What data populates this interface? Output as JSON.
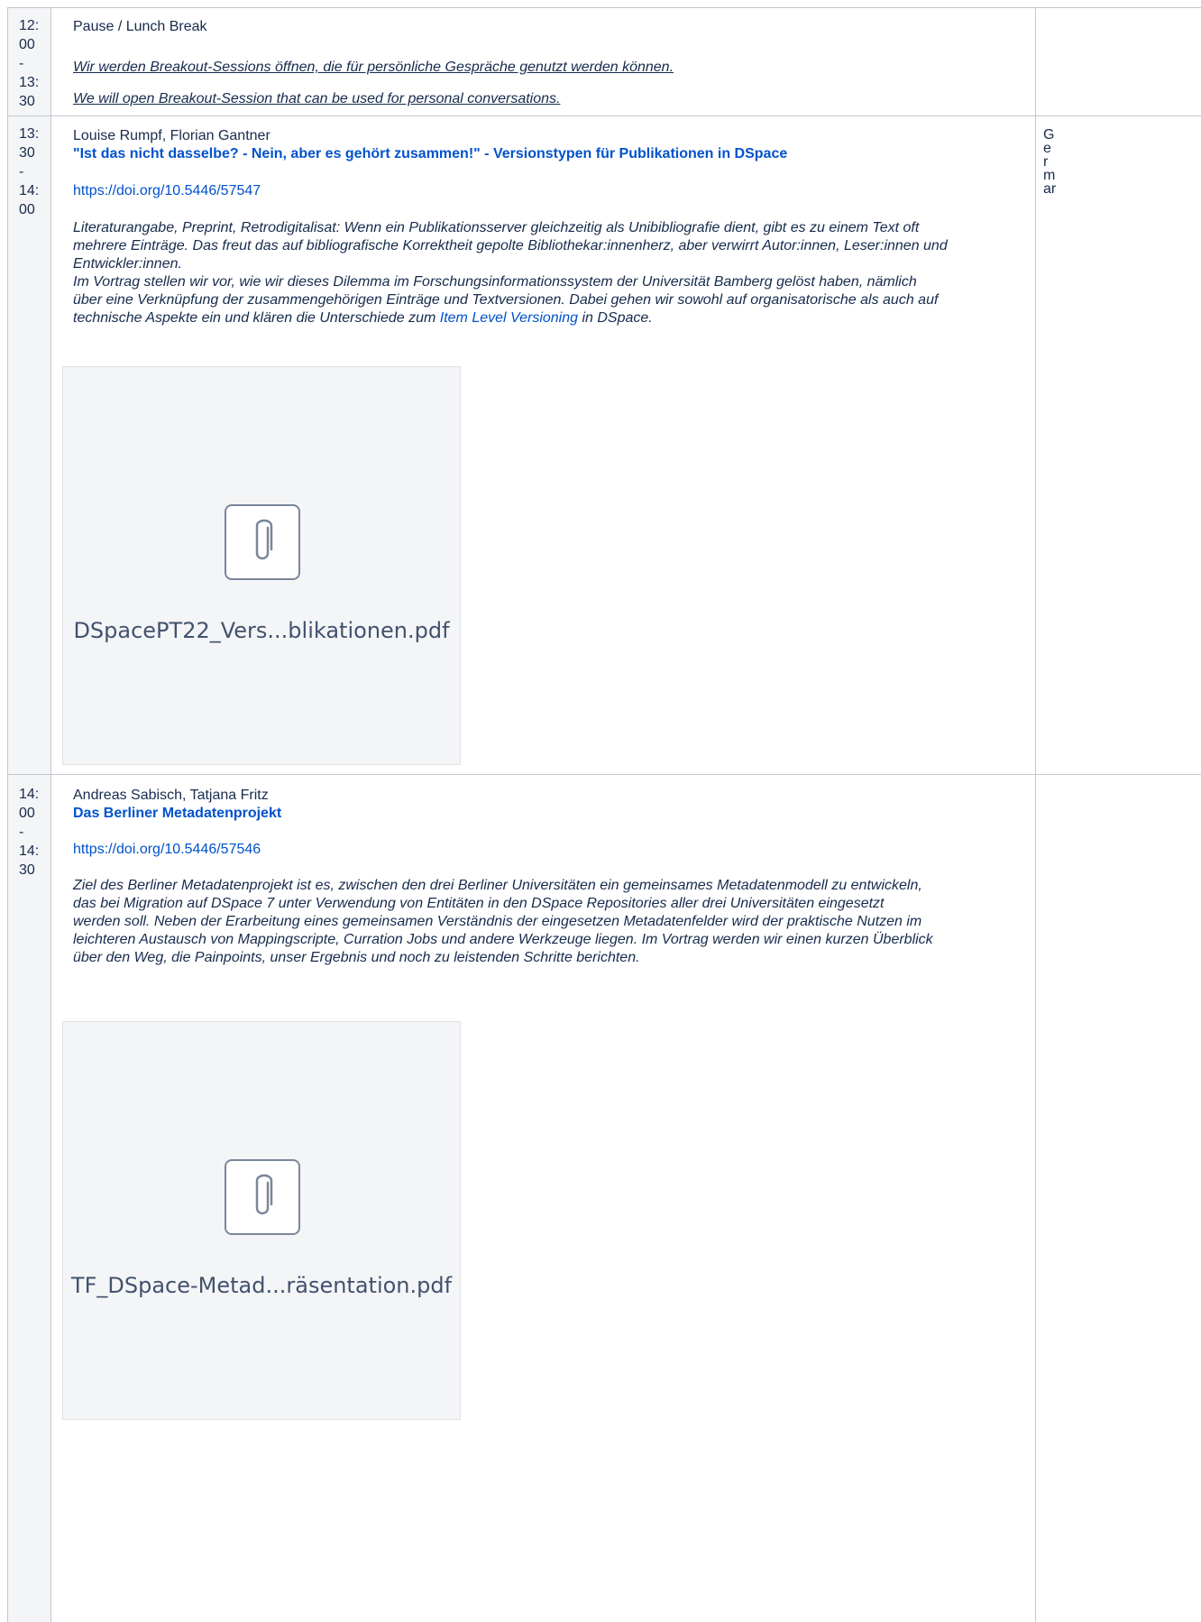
{
  "rows": [
    {
      "time": [
        "12:",
        "00",
        "-",
        "13:",
        "30"
      ],
      "title": "Pause / Lunch Break",
      "notes": [
        "Wir werden Breakout-Sessions öffnen, die für persönliche Gespräche genutzt werden können.",
        "We will open Breakout-Session that can be used for personal conversations."
      ]
    },
    {
      "time": [
        "13:",
        "30",
        "-",
        "14:",
        "00"
      ],
      "speakers": "Louise Rumpf, Florian Gantner",
      "title": "\"Ist das nicht dasselbe? - Nein, aber es gehört zusammen!\" - Versionstypen für Publikationen in DSpace",
      "doi": "https://doi.org/10.5446/57547",
      "abstract_lines": [
        "Literaturangabe, Preprint, Retrodigitalisat: Wenn ein Publikationsserver gleichzeitig als Unibibliografie dient, gibt es zu einem Text oft",
        "mehrere Einträge. Das freut das auf bibliografische Korrektheit gepolte Bibliothekar:innenherz, aber verwirrt Autor:innen, Leser:innen und",
        "Entwickler:innen.",
        "Im Vortrag stellen wir vor, wie wir dieses Dilemma im Forschungsinformationssystem der Universität Bamberg gelöst haben, nämlich",
        "über eine Verknüpfung der zusammengehörigen Einträge und Textversionen. Dabei gehen wir sowohl auf organisatorische als auch auf"
      ],
      "abstract_last": {
        "before": "technische Aspekte ein und klären die Unterschiede zum ",
        "link": "Item Level Versioning",
        "after": " in DSpace."
      },
      "attachment": "DSpacePT22_Vers...blikationen.pdf",
      "side": [
        "G",
        "e",
        "r",
        "m",
        "ar"
      ]
    },
    {
      "time": [
        "14:",
        "00",
        "-",
        "14:",
        "30"
      ],
      "speakers": "Andreas Sabisch, Tatjana Fritz",
      "title": "Das Berliner Metadatenprojekt",
      "doi": "https://doi.org/10.5446/57546",
      "abstract_lines": [
        "Ziel des Berliner Metadatenprojekt ist es, zwischen den drei Berliner Universitäten ein gemeinsames Metadatenmodell zu entwickeln,",
        "das bei Migration auf DSpace 7 unter Verwendung von Entitäten in den DSpace Repositories aller drei Universitäten eingesetzt",
        "werden soll. Neben der Erarbeitung eines gemeinsamen Verständnis der eingesetzen Metadatenfelder wird der praktische Nutzen im",
        "leichteren Austausch von Mappingscripte, Curration Jobs und andere Werkzeuge liegen. Im Vortrag werden wir einen kurzen Überblick",
        "über den Weg, die Painpoints, unser Ergebnis und noch zu leistenden Schritte berichten."
      ],
      "attachment": "TF_DSpace-Metad...räsentation.pdf"
    }
  ]
}
